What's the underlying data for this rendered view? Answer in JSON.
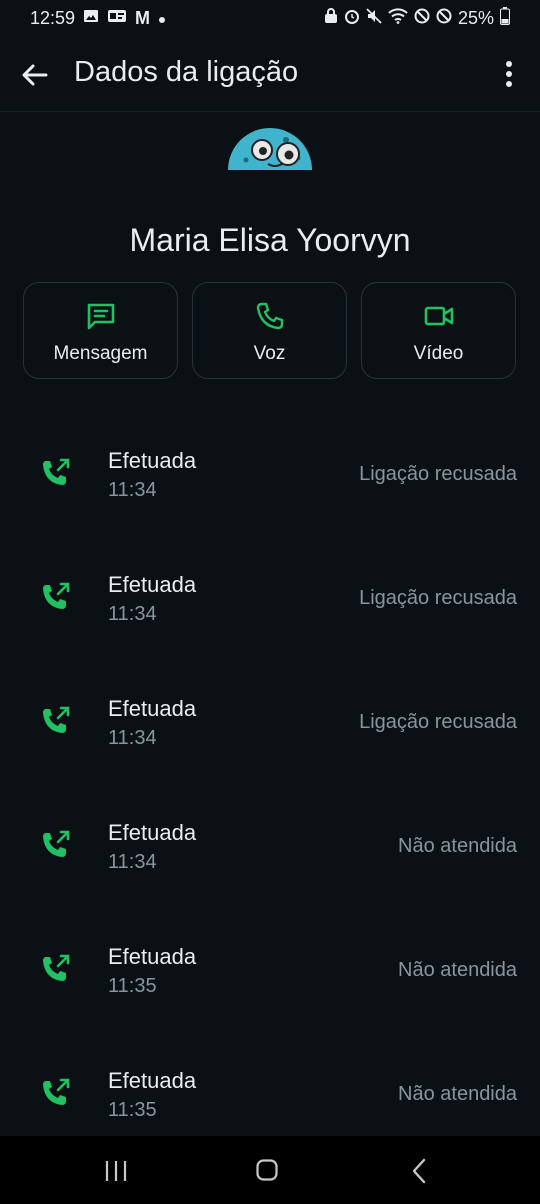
{
  "status_bar": {
    "time": "12:59",
    "left_icons": [
      "gallery-icon",
      "card-icon",
      "gmail-icon",
      "dot-icon"
    ],
    "right_icons": [
      "lock-icon",
      "alarm-icon",
      "mute-icon",
      "wifi-icon",
      "block-icon",
      "block-icon",
      "battery-icon"
    ],
    "battery": "25%"
  },
  "app_bar": {
    "title": "Dados da ligação",
    "back_icon": "arrow-left-icon",
    "menu_icon": "more-vertical-icon"
  },
  "contact": {
    "name": "Maria Elisa Yoorvyn"
  },
  "actions": [
    {
      "label": "Mensagem",
      "icon": "message-icon"
    },
    {
      "label": "Voz",
      "icon": "phone-icon"
    },
    {
      "label": "Vídeo",
      "icon": "video-icon"
    }
  ],
  "calls": [
    {
      "type": "Efetuada",
      "time": "11:34",
      "status": "Ligação recusada"
    },
    {
      "type": "Efetuada",
      "time": "11:34",
      "status": "Ligação recusada"
    },
    {
      "type": "Efetuada",
      "time": "11:34",
      "status": "Ligação recusada"
    },
    {
      "type": "Efetuada",
      "time": "11:34",
      "status": "Não atendida"
    },
    {
      "type": "Efetuada",
      "time": "11:35",
      "status": "Não atendida"
    },
    {
      "type": "Efetuada",
      "time": "11:35",
      "status": "Não atendida"
    }
  ],
  "colors": {
    "background": "#0b1014",
    "accent": "#21c063",
    "text_primary": "#e9edef",
    "text_secondary": "#8696a0",
    "border": "#2a3338"
  }
}
